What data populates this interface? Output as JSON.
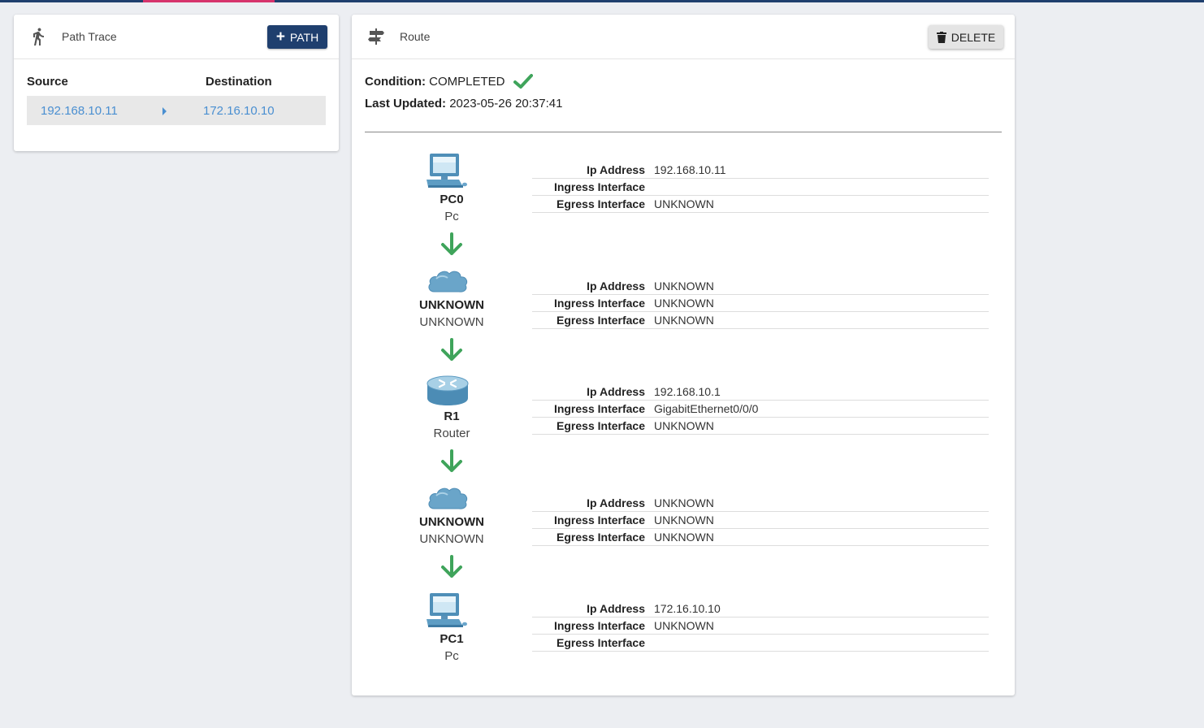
{
  "left_panel": {
    "title": "Path Trace",
    "add_button_label": "PATH",
    "columns": {
      "source": "Source",
      "destination": "Destination"
    },
    "paths": [
      {
        "source": "192.168.10.11",
        "destination": "172.16.10.10"
      }
    ]
  },
  "right_panel": {
    "title": "Route",
    "delete_button_label": "DELETE",
    "condition_label": "Condition:",
    "condition_value": "COMPLETED",
    "last_updated_label": "Last Updated:",
    "last_updated_value": "2023-05-26 20:37:41",
    "detail_labels": {
      "ip": "Ip Address",
      "ingress": "Ingress Interface",
      "egress": "Egress Interface"
    },
    "hops": [
      {
        "icon": "pc-icon",
        "name": "PC0",
        "type": "Pc",
        "ip": "192.168.10.11",
        "ingress": "",
        "egress": "UNKNOWN"
      },
      {
        "icon": "cloud-icon",
        "name": "UNKNOWN",
        "type": "UNKNOWN",
        "ip": "UNKNOWN",
        "ingress": "UNKNOWN",
        "egress": "UNKNOWN"
      },
      {
        "icon": "router-icon",
        "name": "R1",
        "type": "Router",
        "ip": "192.168.10.1",
        "ingress": "GigabitEthernet0/0/0",
        "egress": "UNKNOWN"
      },
      {
        "icon": "cloud-icon",
        "name": "UNKNOWN",
        "type": "UNKNOWN",
        "ip": "UNKNOWN",
        "ingress": "UNKNOWN",
        "egress": "UNKNOWN"
      },
      {
        "icon": "pc-icon",
        "name": "PC1",
        "type": "Pc",
        "ip": "172.16.10.10",
        "ingress": "UNKNOWN",
        "egress": ""
      }
    ]
  },
  "colors": {
    "primary": "#1f3f6e",
    "accent": "#d6336c",
    "link": "#4a8fd1",
    "success": "#3fa45b"
  }
}
